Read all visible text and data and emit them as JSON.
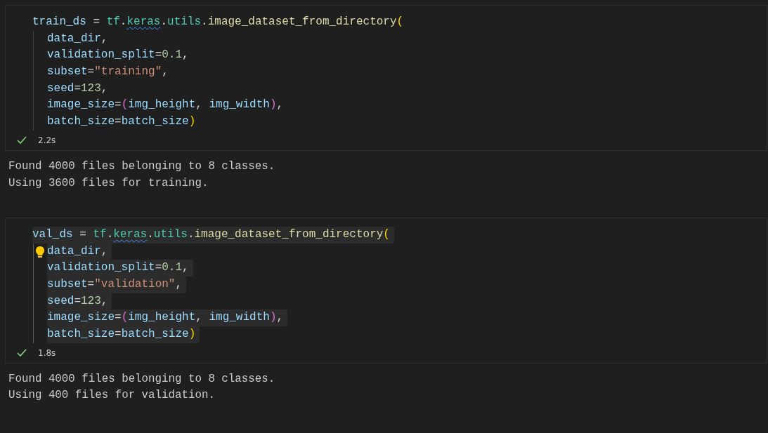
{
  "cells": [
    {
      "focused": false,
      "succeeded": true,
      "duration": "2.2s",
      "code": {
        "tokens": [
          {
            "text": "train_ds",
            "kind": "var"
          },
          {
            "text": " = ",
            "kind": "op"
          },
          {
            "text": "tf",
            "kind": "module"
          },
          {
            "text": ".",
            "kind": "op"
          },
          {
            "text": "keras",
            "kind": "warned"
          },
          {
            "text": ".",
            "kind": "op"
          },
          {
            "text": "utils",
            "kind": "module"
          },
          {
            "text": ".",
            "kind": "op"
          },
          {
            "text": "image_dataset_from_directory",
            "kind": "func"
          },
          {
            "text": "(",
            "kind": "paren"
          }
        ],
        "children": [
          {
            "tokens": [
              {
                "text": "data_dir",
                "kind": "var"
              },
              {
                "text": ",",
                "kind": "op"
              }
            ]
          },
          {
            "tokens": [
              {
                "text": "validation_split",
                "kind": "var"
              },
              {
                "text": "=",
                "kind": "op"
              },
              {
                "text": "0.1",
                "kind": "num"
              },
              {
                "text": ",",
                "kind": "op"
              }
            ]
          },
          {
            "tokens": [
              {
                "text": "subset",
                "kind": "var"
              },
              {
                "text": "=",
                "kind": "op"
              },
              {
                "text": "\"training\"",
                "kind": "str"
              },
              {
                "text": ",",
                "kind": "op"
              }
            ]
          },
          {
            "tokens": [
              {
                "text": "seed",
                "kind": "var"
              },
              {
                "text": "=",
                "kind": "op"
              },
              {
                "text": "123",
                "kind": "num"
              },
              {
                "text": ",",
                "kind": "op"
              }
            ]
          },
          {
            "tokens": [
              {
                "text": "image_size",
                "kind": "var"
              },
              {
                "text": "=",
                "kind": "op"
              },
              {
                "text": "(",
                "kind": "paren2"
              },
              {
                "text": "img_height",
                "kind": "var"
              },
              {
                "text": ", ",
                "kind": "op"
              },
              {
                "text": "img_width",
                "kind": "var"
              },
              {
                "text": ")",
                "kind": "paren2"
              },
              {
                "text": ",",
                "kind": "op"
              }
            ]
          },
          {
            "tokens": [
              {
                "text": "batch_size",
                "kind": "var"
              },
              {
                "text": "=",
                "kind": "op"
              },
              {
                "text": "batch_size",
                "kind": "var"
              },
              {
                "text": ")",
                "kind": "paren"
              }
            ]
          }
        ]
      },
      "output": [
        "Found 4000 files belonging to 8 classes.",
        "Using 3600 files for training."
      ]
    },
    {
      "focused": true,
      "succeeded": true,
      "duration": "1.8s",
      "code": {
        "tokens": [
          {
            "text": "val_ds",
            "kind": "var"
          },
          {
            "text": " = ",
            "kind": "op"
          },
          {
            "text": "tf",
            "kind": "module"
          },
          {
            "text": ".",
            "kind": "op"
          },
          {
            "text": "keras",
            "kind": "warned"
          },
          {
            "text": ".",
            "kind": "op"
          },
          {
            "text": "utils",
            "kind": "module"
          },
          {
            "text": ".",
            "kind": "op"
          },
          {
            "text": "image_dataset_from_directory",
            "kind": "func"
          },
          {
            "text": "(",
            "kind": "paren"
          }
        ],
        "children": [
          {
            "tokens": [
              {
                "text": "data_dir",
                "kind": "var"
              },
              {
                "text": ",",
                "kind": "op"
              }
            ]
          },
          {
            "tokens": [
              {
                "text": "validation_split",
                "kind": "var"
              },
              {
                "text": "=",
                "kind": "op"
              },
              {
                "text": "0.1",
                "kind": "num"
              },
              {
                "text": ",",
                "kind": "op"
              }
            ]
          },
          {
            "tokens": [
              {
                "text": "subset",
                "kind": "var"
              },
              {
                "text": "=",
                "kind": "op"
              },
              {
                "text": "\"validation\"",
                "kind": "str"
              },
              {
                "text": ",",
                "kind": "op"
              }
            ]
          },
          {
            "tokens": [
              {
                "text": "seed",
                "kind": "var"
              },
              {
                "text": "=",
                "kind": "op"
              },
              {
                "text": "123",
                "kind": "num"
              },
              {
                "text": ",",
                "kind": "op"
              }
            ]
          },
          {
            "tokens": [
              {
                "text": "image_size",
                "kind": "var"
              },
              {
                "text": "=",
                "kind": "op"
              },
              {
                "text": "(",
                "kind": "paren2"
              },
              {
                "text": "img_height",
                "kind": "var"
              },
              {
                "text": ", ",
                "kind": "op"
              },
              {
                "text": "img_width",
                "kind": "var"
              },
              {
                "text": ")",
                "kind": "paren2"
              },
              {
                "text": ",",
                "kind": "op"
              }
            ]
          },
          {
            "tokens": [
              {
                "text": "batch_size",
                "kind": "var"
              },
              {
                "text": "=",
                "kind": "op"
              },
              {
                "text": "batch_size",
                "kind": "var"
              },
              {
                "text": ")",
                "kind": "paren"
              }
            ]
          }
        ]
      },
      "output": [
        "Found 4000 files belonging to 8 classes.",
        "Using 400 files for validation."
      ]
    }
  ]
}
